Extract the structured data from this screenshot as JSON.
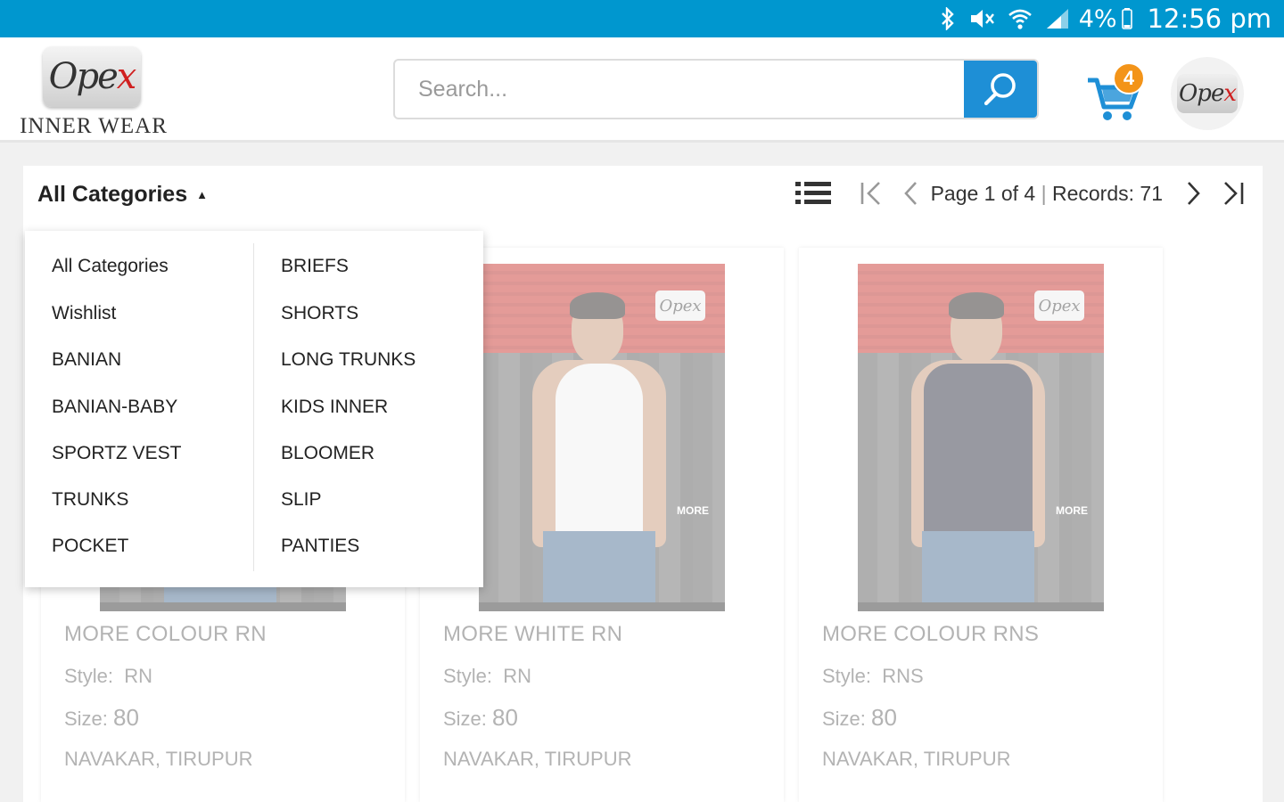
{
  "status_bar": {
    "battery": "4%",
    "time": "12:56 pm",
    "icons": [
      "bluetooth-icon",
      "mute-icon",
      "wifi-icon",
      "signal-icon",
      "battery-icon"
    ]
  },
  "header": {
    "logo_caption": "INNER WEAR",
    "logo_text": "Opex",
    "search_placeholder": "Search...",
    "cart_count": "4",
    "avatar_text": "Opex"
  },
  "toolbar": {
    "category_label": "All Categories",
    "caret": "▲",
    "page_text": "Page 1 of 4",
    "separator": "|",
    "records_text": "Records: 71"
  },
  "categories": {
    "left": [
      "All Categories",
      "Wishlist",
      "BANIAN",
      "BANIAN-BABY",
      "SPORTZ VEST",
      "TRUNKS",
      "POCKET"
    ],
    "right": [
      "BRIEFS",
      "SHORTS",
      "LONG TRUNKS",
      "KIDS INNER",
      "BLOOMER",
      "SLIP",
      "PANTIES"
    ]
  },
  "products": [
    {
      "name": "MORE COLOUR RN",
      "style_label": "Style:",
      "style": "RN",
      "size_label": "Size:",
      "size": "80",
      "location": "NAVAKAR, TIRUPUR",
      "shirt_color": "#6b6b6b"
    },
    {
      "name": "MORE WHITE RN",
      "style_label": "Style:",
      "style": "RN",
      "size_label": "Size:",
      "size": "80",
      "location": "NAVAKAR, TIRUPUR",
      "shirt_color": "#f2f2f2"
    },
    {
      "name": "MORE COLOUR RNS",
      "style_label": "Style:",
      "style": "RNS",
      "size_label": "Size:",
      "size": "80",
      "location": "NAVAKAR, TIRUPUR",
      "shirt_color": "#2e2f3f"
    }
  ],
  "colors": {
    "status_bar": "#0097cf",
    "search_button": "#1e8fd6",
    "cart_badge": "#f39419",
    "cart_icon": "#1e8fd6"
  }
}
